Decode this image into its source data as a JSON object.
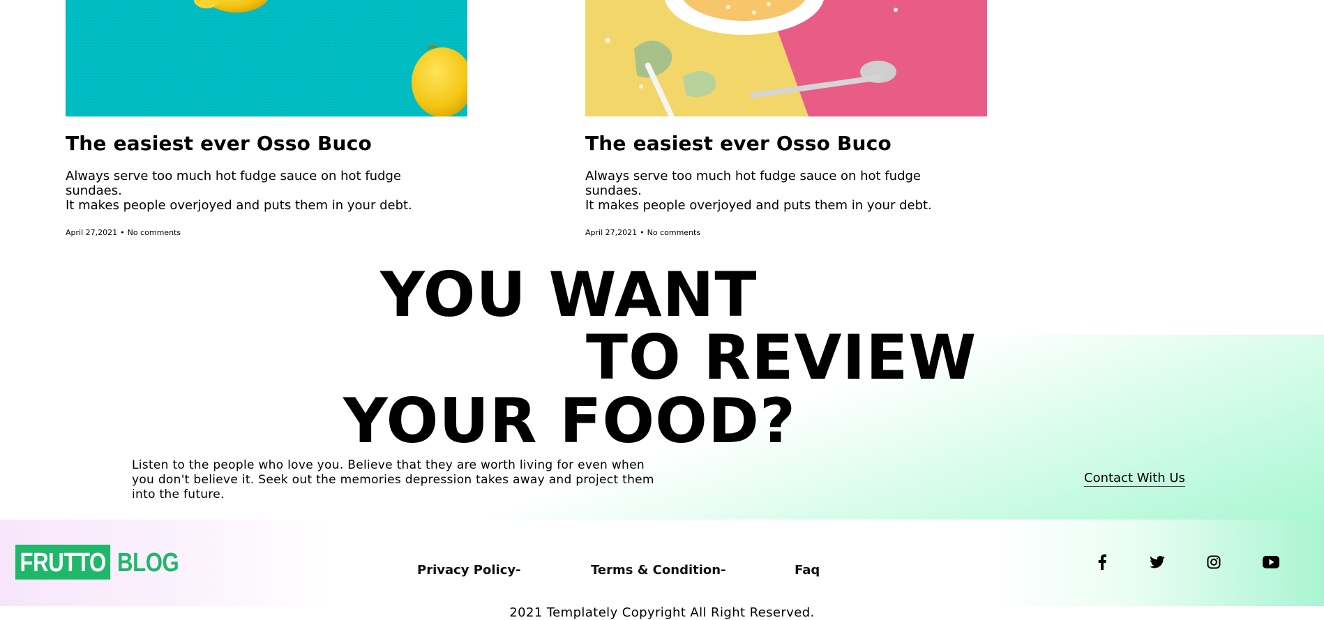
{
  "posts": [
    {
      "title": "The easiest ever Osso Buco",
      "excerpt_line1": "Always serve too much hot fudge sauce on hot fudge sundaes.",
      "excerpt_line2": "It makes people overjoyed and puts them in your debt.",
      "date": "April 27,2021",
      "separator": "•",
      "comments": "No comments"
    },
    {
      "title": "The easiest ever Osso Buco",
      "excerpt_line1": "Always serve too much hot fudge sauce on hot fudge sundaes.",
      "excerpt_line2": "It makes people overjoyed and puts them in your debt.",
      "date": "April 27,2021",
      "separator": "•",
      "comments": "No comments"
    }
  ],
  "cta": {
    "line1": "YOU WANT",
    "line2": "TO REVIEW",
    "line3": "YOUR FOOD?",
    "text_line1": "Listen to the people who love you. Believe that they are worth living for even when",
    "text_line2": "you don't believe it. Seek out the memories depression takes away and project them",
    "text_line3": "into the future.",
    "contact_label": "Contact With Us"
  },
  "footer": {
    "logo_part1": "FRUTTO",
    "logo_part2": "BLOG",
    "links": [
      "Privacy Policy-",
      "Terms & Condition-",
      "Faq"
    ],
    "social": [
      "facebook-icon",
      "twitter-icon",
      "instagram-icon",
      "youtube-icon"
    ],
    "copyright": "2021 Templately Copyright All Right Reserved."
  },
  "colors": {
    "brand_green": "#1fb86b",
    "teal_background": "#00bcc3",
    "lemon": "#f5cd14",
    "pink": "#e85c86",
    "yellow": "#f2d669"
  }
}
